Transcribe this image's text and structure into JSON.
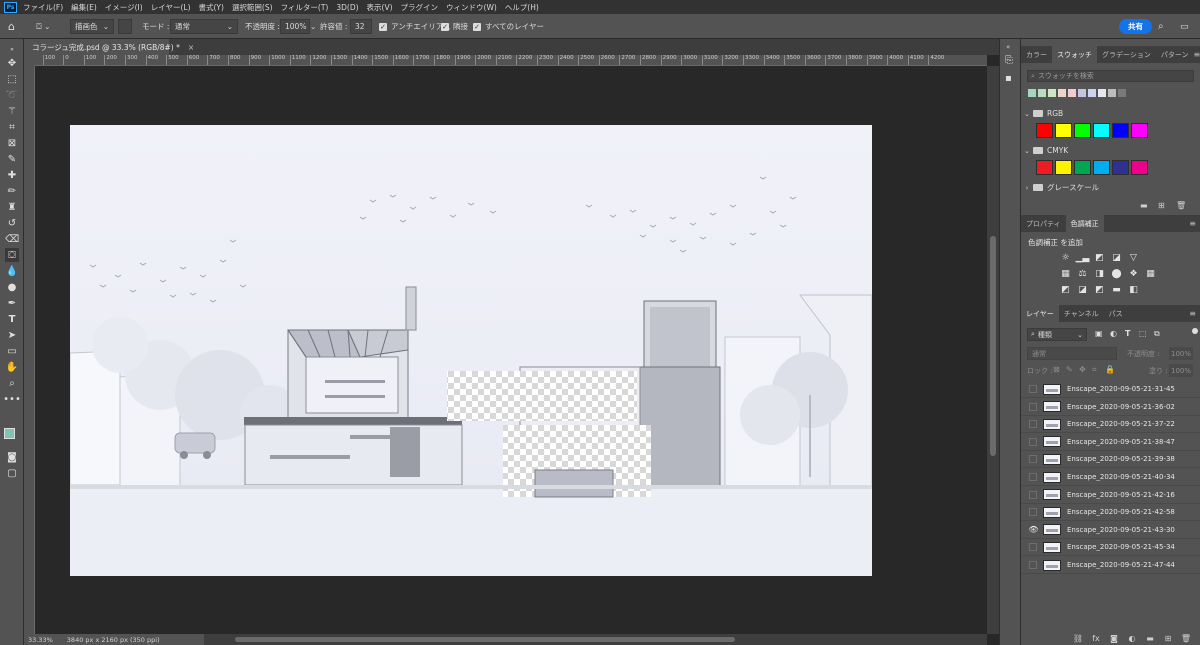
{
  "menubar": {
    "items": [
      "ファイル(F)",
      "編集(E)",
      "イメージ(I)",
      "レイヤー(L)",
      "書式(Y)",
      "選択範囲(S)",
      "フィルター(T)",
      "3D(D)",
      "表示(V)",
      "プラグイン",
      "ウィンドウ(W)",
      "ヘルプ(H)"
    ]
  },
  "options": {
    "fill_source": "描画色",
    "mode_label": "モード :",
    "mode_value": "通常",
    "opacity_label": "不透明度 :",
    "opacity_value": "100%",
    "tolerance_label": "許容値 :",
    "tolerance_value": "32",
    "antialias": "アンチエイリアス",
    "contiguous": "隣接",
    "all_layers": "すべてのレイヤー",
    "share": "共有"
  },
  "document": {
    "tab_title": "コラージュ完成.psd @ 33.3% (RGB/8#) *",
    "close": "×"
  },
  "ruler": {
    "ticks": [
      "200",
      "100",
      "0",
      "100",
      "200",
      "300",
      "400",
      "500",
      "600",
      "700",
      "800",
      "900",
      "1000",
      "1100",
      "1200",
      "1300",
      "1400",
      "1500",
      "1600",
      "1700",
      "1800",
      "1900",
      "2000",
      "2100",
      "2200",
      "2300",
      "2400",
      "2500",
      "2600",
      "2700",
      "2800",
      "2900",
      "3000",
      "3100",
      "3200",
      "3300",
      "3400",
      "3500",
      "3600",
      "3700",
      "3800",
      "3900",
      "4000",
      "4100",
      "4200"
    ]
  },
  "status": {
    "zoom": "33.33%",
    "doc_info": "3840 px x 2160 px (350 ppi)"
  },
  "swatches_panel": {
    "tabs": [
      "カラー",
      "スウォッチ",
      "グラデーション",
      "パターン"
    ],
    "active_tab": "スウォッチ",
    "search_placeholder": "スウォッチを検索",
    "recent_colors": [
      "#a5d6be",
      "#b6dcc1",
      "#cde5c0",
      "#ead7c5",
      "#f3c9d2",
      "#c7c2e4",
      "#ccd3ec",
      "#e7e7ef",
      "#bdbdbd",
      "#7a7a7a"
    ],
    "groups": [
      {
        "name": "RGB",
        "colors": [
          "#ff0000",
          "#ffff00",
          "#00ff00",
          "#00ffff",
          "#0000ff",
          "#ff00ff"
        ]
      },
      {
        "name": "CMYK",
        "colors": [
          "#ed1c24",
          "#fff200",
          "#00a651",
          "#00aeef",
          "#2e3192",
          "#ec008c"
        ]
      },
      {
        "name": "グレースケール",
        "colors": []
      }
    ]
  },
  "adjustments_panel": {
    "tabs": [
      "プロパティ",
      "色調補正"
    ],
    "active_tab": "色調補正",
    "title": "色調補正 を追加"
  },
  "layers_panel": {
    "tabs": [
      "レイヤー",
      "チャンネル",
      "パス"
    ],
    "active_tab": "レイヤー",
    "filter_kind": "種類",
    "blend_mode": "通常",
    "opacity_label": "不透明度 :",
    "opacity_value": "100%",
    "lock_label": "ロック :",
    "fill_label": "塗り :",
    "fill_value": "100%",
    "layers": [
      {
        "name": "Enscape_2020-09-05-21-31-45",
        "visible": false
      },
      {
        "name": "Enscape_2020-09-05-21-36-02",
        "visible": false
      },
      {
        "name": "Enscape_2020-09-05-21-37-22",
        "visible": false
      },
      {
        "name": "Enscape_2020-09-05-21-38-47",
        "visible": false
      },
      {
        "name": "Enscape_2020-09-05-21-39-38",
        "visible": false
      },
      {
        "name": "Enscape_2020-09-05-21-40-34",
        "visible": false
      },
      {
        "name": "Enscape_2020-09-05-21-42-16",
        "visible": false
      },
      {
        "name": "Enscape_2020-09-05-21-42-58",
        "visible": false
      },
      {
        "name": "Enscape_2020-09-05-21-43-30",
        "visible": true
      },
      {
        "name": "Enscape_2020-09-05-21-45-34",
        "visible": false
      },
      {
        "name": "Enscape_2020-09-05-21-47-44",
        "visible": false
      }
    ]
  },
  "colors": {
    "foreground": "#7ec4b4",
    "background": "#ffffff",
    "accent": "#1473e6"
  }
}
